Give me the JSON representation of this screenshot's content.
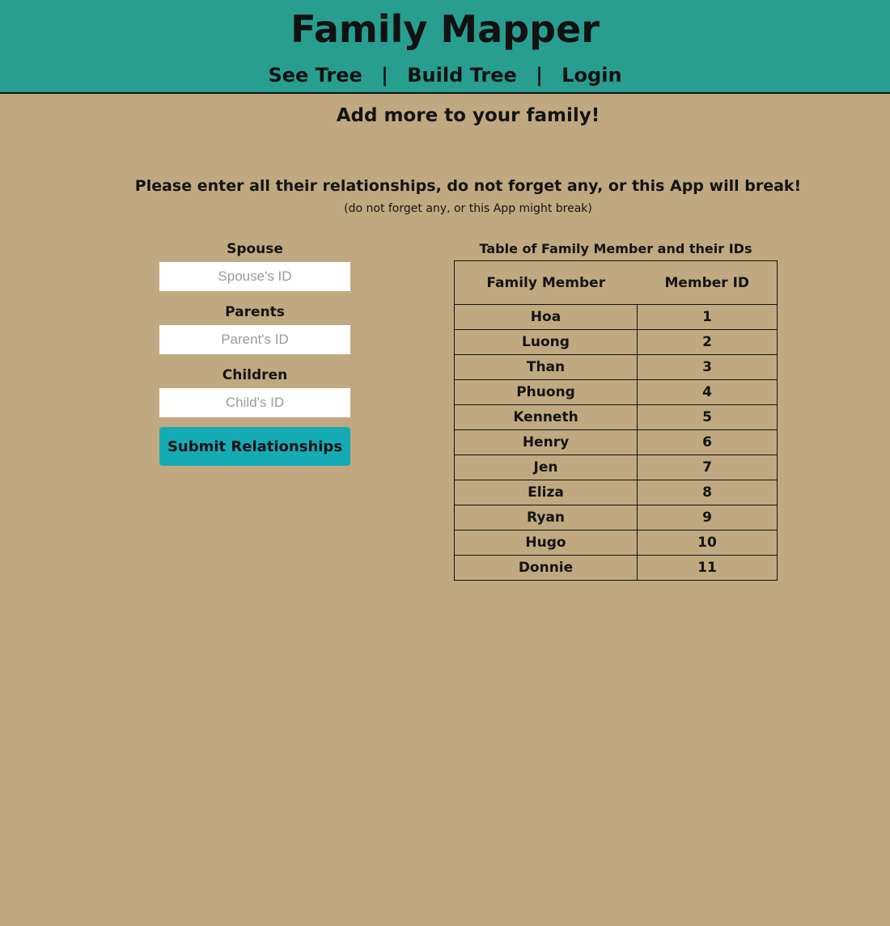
{
  "header": {
    "title": "Family Mapper",
    "nav": {
      "see_tree": "See Tree",
      "build_tree": "Build Tree",
      "login": "Login",
      "separator": "|"
    }
  },
  "page": {
    "subtitle": "Add more to your family!",
    "warning": "Please enter all their relationships, do not forget any, or this App will break!",
    "warning_sub": "(do not forget any, or this App might break)"
  },
  "form": {
    "spouse_label": "Spouse",
    "spouse_placeholder": "Spouse's ID",
    "parents_label": "Parents",
    "parents_placeholder": "Parent's ID",
    "children_label": "Children",
    "children_placeholder": "Child's ID",
    "submit_label": "Submit Relationships"
  },
  "members_table": {
    "caption": "Table of Family Member and their IDs",
    "headers": [
      "Family Member",
      "Member ID"
    ],
    "rows": [
      {
        "name": "Hoa",
        "id": "1"
      },
      {
        "name": "Luong",
        "id": "2"
      },
      {
        "name": "Than",
        "id": "3"
      },
      {
        "name": "Phuong",
        "id": "4"
      },
      {
        "name": "Kenneth",
        "id": "5"
      },
      {
        "name": "Henry",
        "id": "6"
      },
      {
        "name": "Jen",
        "id": "7"
      },
      {
        "name": "Eliza",
        "id": "8"
      },
      {
        "name": "Ryan",
        "id": "9"
      },
      {
        "name": "Hugo",
        "id": "10"
      },
      {
        "name": "Donnie",
        "id": "11"
      }
    ]
  },
  "colors": {
    "header_bg": "#289e90",
    "page_bg": "#c0a980",
    "button_bg": "#14abb5"
  }
}
